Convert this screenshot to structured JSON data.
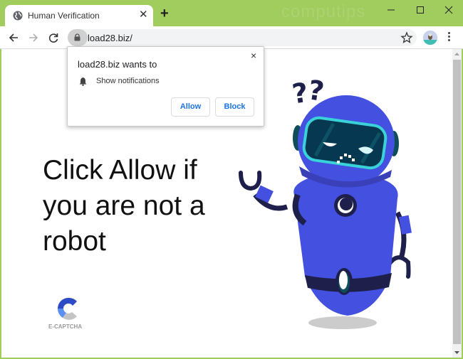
{
  "browser": {
    "tab": {
      "title": "Human Verification",
      "icon": "globe-icon"
    },
    "new_tab_label": "+",
    "watermark": "computips",
    "window_controls": [
      "minimize",
      "maximize",
      "close"
    ],
    "address_bar": {
      "url": "load28.biz/",
      "security_icon": "lock-icon"
    },
    "colors": {
      "frame": "#a1cc5e",
      "link_blue": "#1a73e8"
    }
  },
  "popup": {
    "title": "load28.biz wants to",
    "permission": "Show notifications",
    "permission_icon": "bell-icon",
    "close_label": "×",
    "allow_label": "Allow",
    "block_label": "Block"
  },
  "page": {
    "headline": "Click Allow if you are not a robot",
    "captcha_label": "E-CAPTCHA",
    "illustration": "confused-robot",
    "question_marks": "??"
  }
}
